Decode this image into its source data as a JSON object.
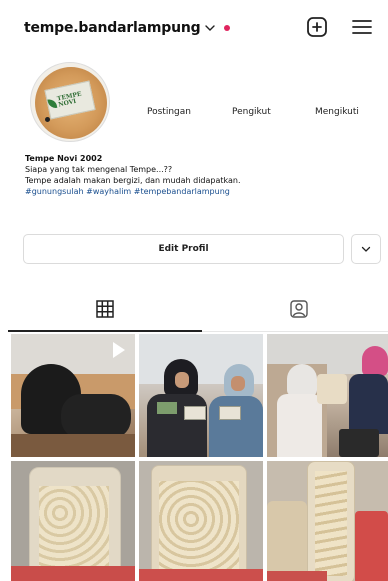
{
  "header": {
    "username": "tempe.bandarlampung",
    "icons": {
      "dropdown": "chevron-down-icon",
      "notification": "red-dot",
      "create": "plus-square-icon",
      "menu": "hamburger-menu-icon"
    }
  },
  "profile": {
    "avatar_logo_text": "TEMPE NOVI",
    "stats": {
      "posts_label": "Postingan",
      "followers_label": "Pengikut",
      "following_label": "Mengikuti"
    },
    "bio": {
      "name": "Tempe Novi 2002",
      "line1": "Siapa yang tak mengenal Tempe...??",
      "line2": "Tempe adalah makan bergizi, dan mudah didapatkan.",
      "hashtags": "#gunungsulah #wayhalim #tempebandarlampung"
    }
  },
  "actions": {
    "edit_profile_label": "Edit Profil",
    "expand_icon": "chevron-down-icon"
  },
  "tabs": [
    {
      "icon": "grid-icon",
      "active": true
    },
    {
      "icon": "tagged-person-icon",
      "active": false
    }
  ],
  "colors": {
    "accent_hashtag": "#1a4f8f",
    "notification_dot": "#e0245e",
    "border": "#dbdbdb"
  },
  "posts": [
    {
      "description": "photo",
      "type": "video"
    },
    {
      "description": "photo",
      "type": "image"
    },
    {
      "description": "photo",
      "type": "image"
    },
    {
      "description": "photo",
      "type": "image"
    },
    {
      "description": "photo",
      "type": "image"
    },
    {
      "description": "photo",
      "type": "image"
    }
  ]
}
